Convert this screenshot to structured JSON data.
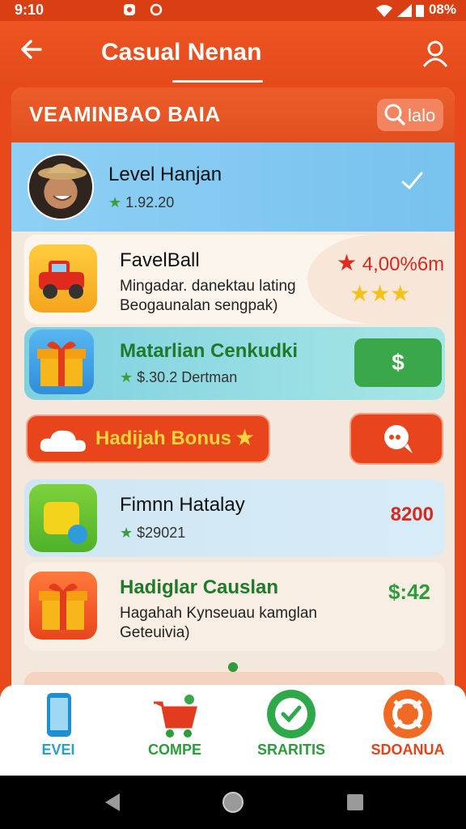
{
  "status_bar": {
    "time": "9:10",
    "battery": "08%",
    "icons": [
      "notification-icon",
      "sync-icon",
      "wifi-icon",
      "signal-icon",
      "battery-icon"
    ]
  },
  "app_bar": {
    "title": "Casual Nenan",
    "back_icon": "arrow-left-icon",
    "profile_icon": "person-icon"
  },
  "panel": {
    "title": "VEAMINBAO BAIA",
    "search_label": "lalo",
    "level_row": {
      "name": "Level Hanjan",
      "score": "1.92.20"
    }
  },
  "cards": [
    {
      "title": "FavelBall",
      "desc": [
        "Mingadar. danektau lating",
        "Beogaunalan sengpak)"
      ],
      "reward": "4,00%6m",
      "stars": 3
    },
    {
      "title": "Matarlian Cenkudki",
      "sub": "$.30.2 Dertman",
      "action_label": "$"
    },
    {
      "bonus_label": "Hadijah Bonus"
    },
    {
      "title": "Fimnn Hatalay",
      "sub": "$29021",
      "value": "8200"
    },
    {
      "title": "Hadiglar Causlan",
      "desc": [
        "Hagahah Kynseuau kamglan",
        "Geteuivia)"
      ],
      "value": "$:42"
    }
  ],
  "bottom_nav": [
    {
      "label": "EVEI",
      "icon": "phone-icon",
      "color": "#2aa0c6"
    },
    {
      "label": "COMPE",
      "icon": "cart-icon",
      "color": "#2c9c3a"
    },
    {
      "label": "SRARITIS",
      "icon": "chat-check-icon",
      "color": "#2c9c3a"
    },
    {
      "label": "SDOANUA",
      "icon": "lifebuoy-icon",
      "color": "#e2441a"
    }
  ],
  "system_nav": [
    "back-icon",
    "home-icon",
    "recents-icon"
  ],
  "colors": {
    "primary": "#e8491c",
    "green": "#3aa84a",
    "blue": "#77c2ee"
  }
}
